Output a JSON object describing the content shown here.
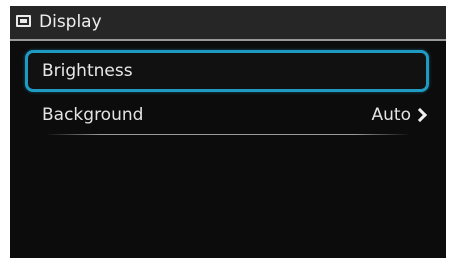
{
  "header": {
    "title": "Display",
    "icon": "display-icon"
  },
  "menu": {
    "items": [
      {
        "label": "Brightness",
        "selected": true
      },
      {
        "label": "Background",
        "value": "Auto",
        "icon": "chevron-right-icon"
      }
    ]
  },
  "colors": {
    "selection_border": "#1f9ac3",
    "background": "#0c0c0c",
    "header_background": "#262626"
  }
}
